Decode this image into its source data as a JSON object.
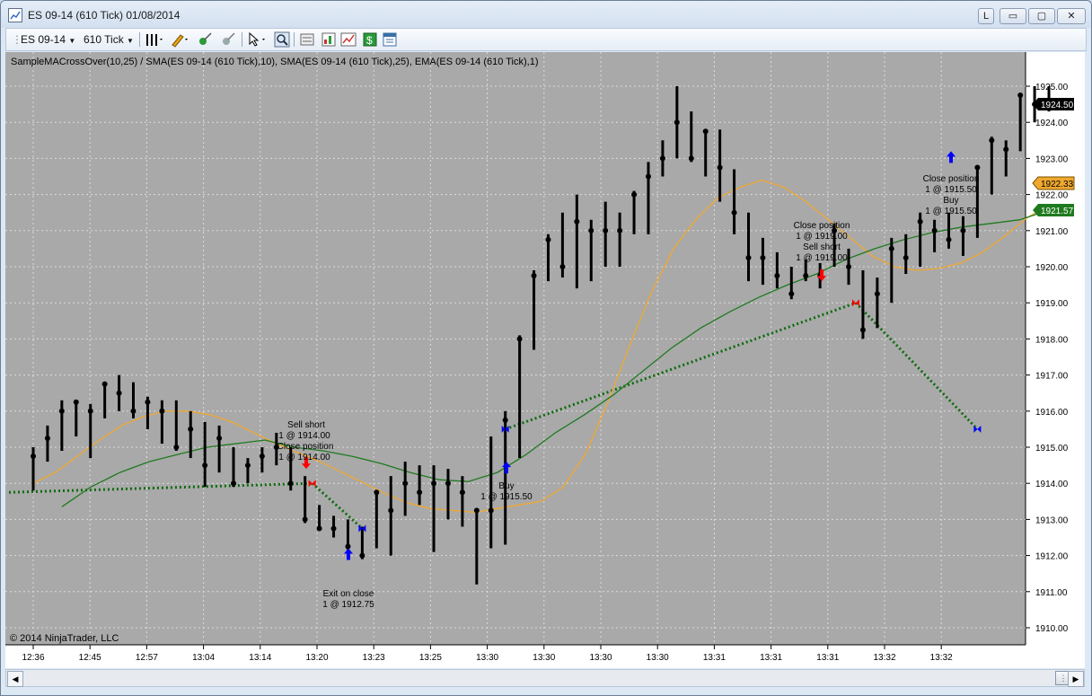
{
  "window": {
    "title": "ES 09-14 (610 Tick)  01/08/2014",
    "btn_l": "L",
    "btn_min": "▭",
    "btn_max": "▢",
    "btn_close": "✕"
  },
  "toolbar": {
    "instrument": "ES 09-14",
    "period": "610 Tick",
    "icons": [
      "bar-style-icon",
      "drawing-pencil-icon",
      "add-marker-icon",
      "erase-icon",
      "cursor-select-icon",
      "zoom-icon",
      "data-box-icon",
      "chart-trader-icon",
      "indicators-icon",
      "strategies-icon",
      "properties-icon"
    ]
  },
  "chart": {
    "header": "SampleMACrossOver(10,25) / SMA(ES 09-14 (610 Tick),10), SMA(ES 09-14 (610 Tick),25), EMA(ES 09-14 (610 Tick),1)",
    "copyright": "© 2014 NinjaTrader, LLC",
    "colors": {
      "background": "#a9a9a9",
      "bars": "#000000",
      "sma10": "#f0a830",
      "sma25": "#1f7a1f",
      "trade_line": "#0d6b0d",
      "buy_arrow": "#0000ff",
      "sell_arrow": "#ff0000"
    },
    "price_labels": [
      {
        "value": "1924.50",
        "style": "black"
      },
      {
        "value": "1922.33",
        "style": "orange"
      },
      {
        "value": "1921.57",
        "style": "green"
      }
    ],
    "annotations": [
      {
        "lines": [
          "Sell short",
          "1 @ 1914.00",
          "Close position",
          "1 @ 1914.00"
        ]
      },
      {
        "lines": [
          "Buy",
          "1 @ 1915.50"
        ]
      },
      {
        "lines": [
          "Exit on close",
          "1 @ 1912.75"
        ]
      },
      {
        "lines": [
          "Close position",
          "1 @ 1919.00",
          "Sell short",
          "1 @ 1919.00"
        ]
      },
      {
        "lines": [
          "Close position",
          "1 @ 1915.50",
          "Buy",
          "1 @ 1915.50"
        ]
      }
    ]
  },
  "chart_data": {
    "type": "line",
    "ylim": [
      1909.5,
      1925.5
    ],
    "y_ticks": [
      "1910.00",
      "1911.00",
      "1912.00",
      "1913.00",
      "1914.00",
      "1915.00",
      "1916.00",
      "1917.00",
      "1918.00",
      "1919.00",
      "1920.00",
      "1921.00",
      "1922.00",
      "1923.00",
      "1924.00",
      "1925.00"
    ],
    "x_ticks": [
      "12:36",
      "12:45",
      "12:57",
      "13:04",
      "13:14",
      "13:20",
      "13:23",
      "13:25",
      "13:30",
      "13:30",
      "13:30",
      "13:30",
      "13:31",
      "13:31",
      "13:31",
      "13:32",
      "13:32"
    ],
    "bars": [
      {
        "high": 1915.0,
        "low": 1913.8,
        "close": 1914.75
      },
      {
        "high": 1915.6,
        "low": 1914.6,
        "close": 1915.25
      },
      {
        "high": 1916.3,
        "low": 1914.9,
        "close": 1916.0
      },
      {
        "high": 1916.3,
        "low": 1915.3,
        "close": 1916.25
      },
      {
        "high": 1916.2,
        "low": 1914.7,
        "close": 1916.0
      },
      {
        "high": 1916.8,
        "low": 1915.8,
        "close": 1916.75
      },
      {
        "high": 1917.0,
        "low": 1916.0,
        "close": 1916.5
      },
      {
        "high": 1916.8,
        "low": 1915.8,
        "close": 1916.0
      },
      {
        "high": 1916.4,
        "low": 1915.5,
        "close": 1916.25
      },
      {
        "high": 1916.3,
        "low": 1915.1,
        "close": 1916.0
      },
      {
        "high": 1916.3,
        "low": 1914.9,
        "close": 1915.0
      },
      {
        "high": 1916.0,
        "low": 1914.7,
        "close": 1915.5
      },
      {
        "high": 1915.7,
        "low": 1913.9,
        "close": 1914.5
      },
      {
        "high": 1915.6,
        "low": 1914.3,
        "close": 1915.25
      },
      {
        "high": 1915.0,
        "low": 1913.9,
        "close": 1914.0
      },
      {
        "high": 1914.7,
        "low": 1914.0,
        "close": 1914.5
      },
      {
        "high": 1915.0,
        "low": 1914.3,
        "close": 1914.75
      },
      {
        "high": 1915.4,
        "low": 1914.5,
        "close": 1915.0
      },
      {
        "high": 1915.0,
        "low": 1913.8,
        "close": 1914.0
      },
      {
        "high": 1914.2,
        "low": 1912.9,
        "close": 1913.0
      },
      {
        "high": 1913.4,
        "low": 1912.7,
        "close": 1912.75
      },
      {
        "high": 1913.1,
        "low": 1912.5,
        "close": 1912.75
      },
      {
        "high": 1913.0,
        "low": 1912.0,
        "close": 1912.25
      },
      {
        "high": 1912.8,
        "low": 1911.9,
        "close": 1912.0
      },
      {
        "high": 1913.8,
        "low": 1912.2,
        "close": 1913.75
      },
      {
        "high": 1914.2,
        "low": 1912.0,
        "close": 1913.25
      },
      {
        "high": 1914.6,
        "low": 1913.1,
        "close": 1914.0
      },
      {
        "high": 1914.5,
        "low": 1913.4,
        "close": 1913.75
      },
      {
        "high": 1914.5,
        "low": 1912.1,
        "close": 1914.0
      },
      {
        "high": 1914.4,
        "low": 1913.0,
        "close": 1914.0
      },
      {
        "high": 1914.2,
        "low": 1912.8,
        "close": 1913.75
      },
      {
        "high": 1913.2,
        "low": 1911.2,
        "close": 1913.25
      },
      {
        "high": 1915.3,
        "low": 1912.2,
        "close": 1913.25
      },
      {
        "high": 1916.0,
        "low": 1912.3,
        "close": 1915.75
      },
      {
        "high": 1918.1,
        "low": 1914.7,
        "close": 1918.0
      },
      {
        "high": 1919.9,
        "low": 1917.7,
        "close": 1919.75
      },
      {
        "high": 1920.9,
        "low": 1919.6,
        "close": 1920.75
      },
      {
        "high": 1921.5,
        "low": 1919.7,
        "close": 1920.0
      },
      {
        "high": 1922.0,
        "low": 1919.4,
        "close": 1921.25
      },
      {
        "high": 1921.3,
        "low": 1919.6,
        "close": 1921.0
      },
      {
        "high": 1921.8,
        "low": 1920.0,
        "close": 1921.0
      },
      {
        "high": 1921.5,
        "low": 1920.0,
        "close": 1921.0
      },
      {
        "high": 1922.1,
        "low": 1920.9,
        "close": 1922.0
      },
      {
        "high": 1922.9,
        "low": 1920.9,
        "close": 1922.5
      },
      {
        "high": 1923.5,
        "low": 1922.5,
        "close": 1923.0
      },
      {
        "high": 1925.0,
        "low": 1923.0,
        "close": 1924.0
      },
      {
        "high": 1924.3,
        "low": 1922.9,
        "close": 1923.0
      },
      {
        "high": 1923.8,
        "low": 1922.5,
        "close": 1923.75
      },
      {
        "high": 1923.8,
        "low": 1921.8,
        "close": 1922.75
      },
      {
        "high": 1922.7,
        "low": 1920.9,
        "close": 1921.5
      },
      {
        "high": 1921.5,
        "low": 1919.6,
        "close": 1920.25
      },
      {
        "high": 1920.8,
        "low": 1919.5,
        "close": 1920.25
      },
      {
        "high": 1920.4,
        "low": 1919.4,
        "close": 1919.75
      },
      {
        "high": 1920.0,
        "low": 1919.1,
        "close": 1919.25
      },
      {
        "high": 1920.2,
        "low": 1919.6,
        "close": 1919.75
      },
      {
        "high": 1920.1,
        "low": 1919.4,
        "close": 1919.75
      },
      {
        "high": 1921.2,
        "low": 1920.0,
        "close": 1921.0
      },
      {
        "high": 1920.5,
        "low": 1919.5,
        "close": 1920.0
      },
      {
        "high": 1919.9,
        "low": 1918.0,
        "close": 1918.25
      },
      {
        "high": 1919.7,
        "low": 1918.3,
        "close": 1919.25
      },
      {
        "high": 1920.8,
        "low": 1919.0,
        "close": 1920.5
      },
      {
        "high": 1920.9,
        "low": 1919.8,
        "close": 1920.25
      },
      {
        "high": 1921.5,
        "low": 1920.0,
        "close": 1921.25
      },
      {
        "high": 1921.3,
        "low": 1920.4,
        "close": 1921.0
      },
      {
        "high": 1921.5,
        "low": 1920.5,
        "close": 1920.75
      },
      {
        "high": 1921.4,
        "low": 1920.3,
        "close": 1921.0
      },
      {
        "high": 1922.8,
        "low": 1920.8,
        "close": 1922.75
      },
      {
        "high": 1923.6,
        "low": 1922.0,
        "close": 1923.5
      },
      {
        "high": 1923.5,
        "low": 1922.5,
        "close": 1923.25
      },
      {
        "high": 1924.8,
        "low": 1923.2,
        "close": 1924.75
      },
      {
        "high": 1925.0,
        "low": 1924.0,
        "close": 1924.5
      },
      {
        "high": 1925.0,
        "low": 1924.3,
        "close": 1924.5
      }
    ],
    "series": [
      {
        "values": [
          1914.0,
          1914.3,
          1914.75,
          1915.2,
          1915.6,
          1915.85,
          1916.0,
          1916.0,
          1915.9,
          1915.7,
          1915.4,
          1915.1,
          1914.85,
          1914.6,
          1914.3,
          1914.0,
          1913.7,
          1913.45,
          1913.3,
          1913.25,
          1913.2,
          1913.3,
          1913.4,
          1913.5,
          1913.9,
          1914.8,
          1916.2,
          1917.8,
          1919.3,
          1920.5,
          1921.3,
          1921.9,
          1922.2,
          1922.4,
          1922.2,
          1921.8,
          1921.3,
          1920.8,
          1920.3,
          1920.0,
          1919.9,
          1919.95,
          1920.1,
          1920.4,
          1920.85,
          1921.35,
          1921.7
        ]
      },
      {
        "values": [
          1913.35,
          1913.9,
          1914.3,
          1914.6,
          1914.8,
          1915.0,
          1915.1,
          1915.2,
          1915.0,
          1914.9,
          1914.75,
          1914.55,
          1914.3,
          1914.1,
          1914.05,
          1914.3,
          1914.8,
          1915.4,
          1915.9,
          1916.45,
          1917.1,
          1917.75,
          1918.3,
          1918.75,
          1919.15,
          1919.5,
          1919.8,
          1920.2,
          1920.5,
          1920.75,
          1920.95,
          1921.1,
          1921.2,
          1921.3,
          1921.57
        ]
      }
    ],
    "trades": [
      {
        "x": 0,
        "y": 1913.75
      },
      {
        "x": 19.5,
        "y": 1914.0
      },
      {
        "x": 23,
        "y": 1912.75
      },
      {
        "x": 33,
        "y": 1915.5
      },
      {
        "x": 57.5,
        "y": 1919.0
      },
      {
        "x": 66,
        "y": 1915.5
      }
    ]
  }
}
